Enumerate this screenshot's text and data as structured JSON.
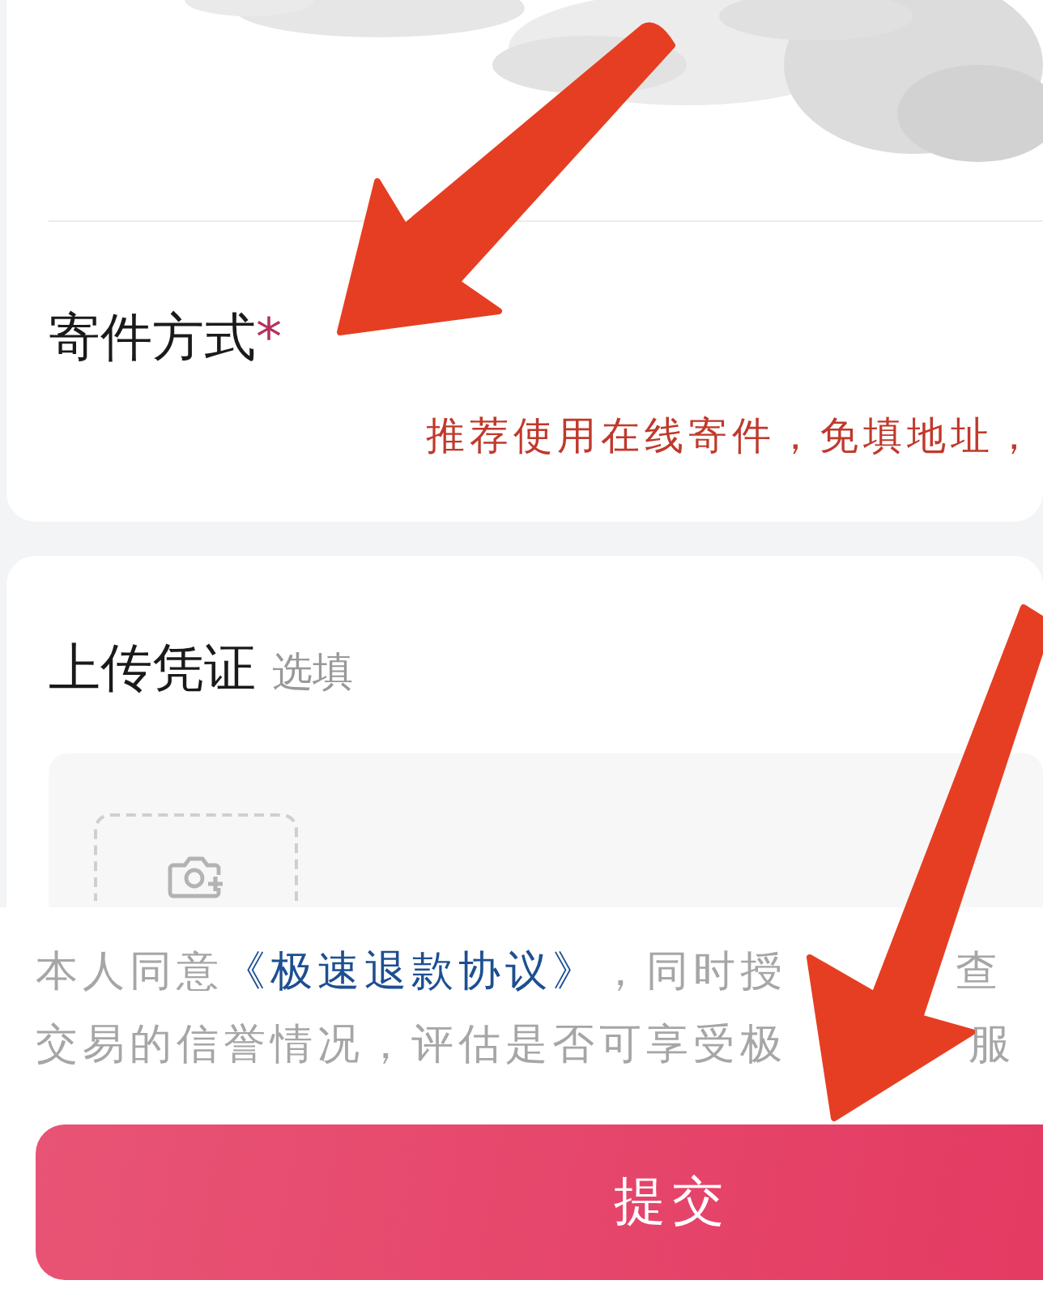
{
  "shipping": {
    "label": "寄件方式",
    "required": true,
    "required_mark": "*",
    "hint": "推荐使用在线寄件，免填地址，"
  },
  "evidence": {
    "title": "上传凭证",
    "optional_tag": "选填"
  },
  "agreement": {
    "before": "本人同意",
    "link": "《极速退款协议》",
    "after_lines": [
      "，同时授",
      "交易的信誉情况，评估是否可享受极"
    ],
    "tails": [
      "查",
      "服"
    ]
  },
  "submit_button": {
    "label": "提交"
  }
}
